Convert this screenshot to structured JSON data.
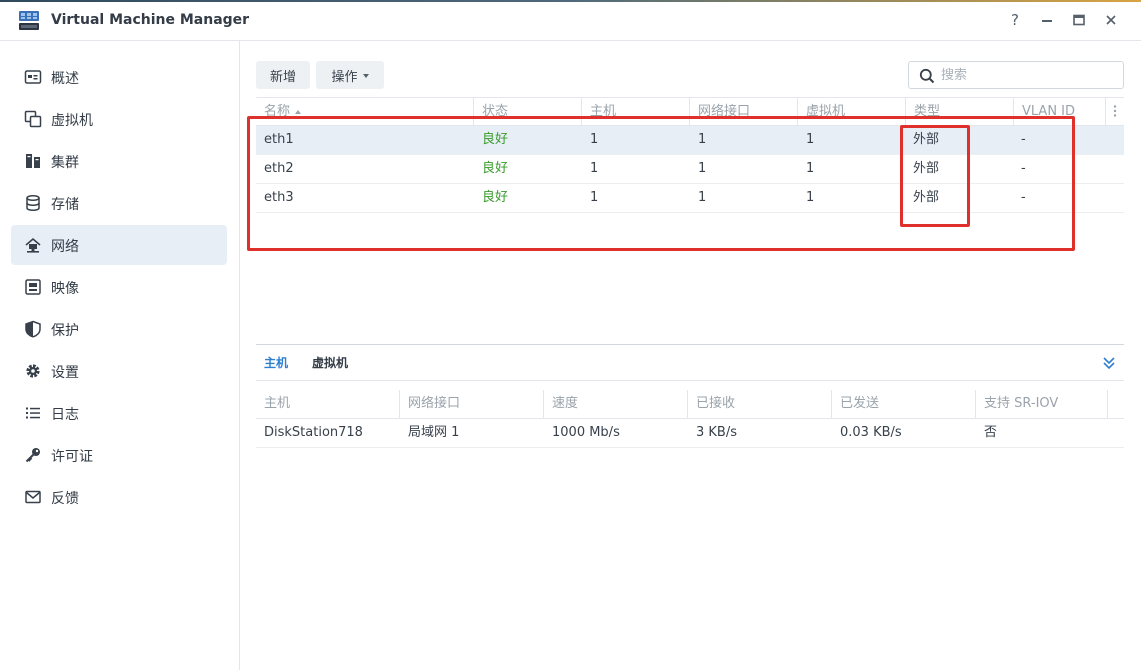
{
  "app": {
    "title": "Virtual Machine Manager",
    "window_buttons": [
      "?",
      "—",
      "□",
      "✕"
    ]
  },
  "sidebar": {
    "items": [
      {
        "label": "概述",
        "icon": "overview-icon"
      },
      {
        "label": "虚拟机",
        "icon": "vm-copy-icon"
      },
      {
        "label": "集群",
        "icon": "cluster-icon"
      },
      {
        "label": "存储",
        "icon": "storage-icon"
      },
      {
        "label": "网络",
        "icon": "network-icon",
        "active": true
      },
      {
        "label": "映像",
        "icon": "image-icon"
      },
      {
        "label": "保护",
        "icon": "shield-icon"
      },
      {
        "label": "设置",
        "icon": "gear-icon"
      },
      {
        "label": "日志",
        "icon": "log-list-icon"
      },
      {
        "label": "许可证",
        "icon": "key-icon"
      },
      {
        "label": "反馈",
        "icon": "mail-icon"
      }
    ]
  },
  "toolbar": {
    "add_label": "新增",
    "action_label": "操作",
    "search_placeholder": "搜索"
  },
  "grid": {
    "headers": [
      "名称",
      "状态",
      "主机",
      "网络接口",
      "虚拟机",
      "类型",
      "VLAN ID"
    ],
    "rows": [
      {
        "name": "eth1",
        "status": "良好",
        "hosts": "1",
        "interfaces": "1",
        "vms": "1",
        "type": "外部",
        "vlan": "-"
      },
      {
        "name": "eth2",
        "status": "良好",
        "hosts": "1",
        "interfaces": "1",
        "vms": "1",
        "type": "外部",
        "vlan": "-"
      },
      {
        "name": "eth3",
        "status": "良好",
        "hosts": "1",
        "interfaces": "1",
        "vms": "1",
        "type": "外部",
        "vlan": "-"
      }
    ]
  },
  "detail": {
    "tabs": [
      "主机",
      "虚拟机"
    ],
    "headers": [
      "主机",
      "网络接口",
      "速度",
      "已接收",
      "已发送",
      "支持 SR-IOV"
    ],
    "row": {
      "host": "DiskStation718",
      "interface": "局域网 1",
      "speed": "1000 Mb/s",
      "received": "3 KB/s",
      "sent": "0.03 KB/s",
      "sriov": "否"
    }
  },
  "colors": {
    "accent": "#2f7fd0",
    "status_ok": "#3a9b2c",
    "annotation": "#e0302c",
    "selected_row": "#e8eef6"
  }
}
